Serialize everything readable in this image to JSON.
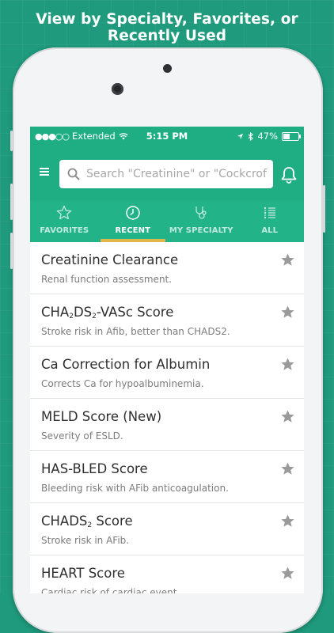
{
  "banner": {
    "text": "View by Specialty, Favorites, or Recently Used"
  },
  "status_bar": {
    "carrier": "Extended",
    "time": "5:15 PM",
    "battery": "47%",
    "battery_level": 0.47
  },
  "search": {
    "placeholder": "Search \"Creatinine\" or \"Cockcroft\""
  },
  "tabs": [
    {
      "label": "FAVORITES",
      "icon": "star-outline-icon",
      "active": false
    },
    {
      "label": "RECENT",
      "icon": "clock-icon",
      "active": true
    },
    {
      "label": "MY SPECIALTY",
      "icon": "stethoscope-icon",
      "active": false
    },
    {
      "label": "ALL",
      "icon": "list-icon",
      "active": false
    }
  ],
  "list": [
    {
      "title": "Creatinine Clearance",
      "desc": "Renal function assessment."
    },
    {
      "title_parts": [
        "CHA",
        "2",
        "DS",
        "2",
        "-VASc Score"
      ],
      "desc": "Stroke risk in Afib, better than CHADS2."
    },
    {
      "title": "Ca Correction for Albumin",
      "desc": "Corrects Ca for hypoalbuminemia."
    },
    {
      "title": "MELD Score (New)",
      "desc": "Severity of ESLD."
    },
    {
      "title": "HAS-BLED Score",
      "desc": "Bleeding risk with AFib anticoagulation."
    },
    {
      "title_parts": [
        "CHADS",
        "2",
        " Score"
      ],
      "desc": "Stroke risk in AFib."
    },
    {
      "title": "HEART Score",
      "desc": "Cardiac risk of cardiac event."
    }
  ],
  "colors": {
    "brand_green": "#1fae84",
    "tab_indicator": "#e0b64c",
    "star_gray": "#9a9a9a"
  }
}
